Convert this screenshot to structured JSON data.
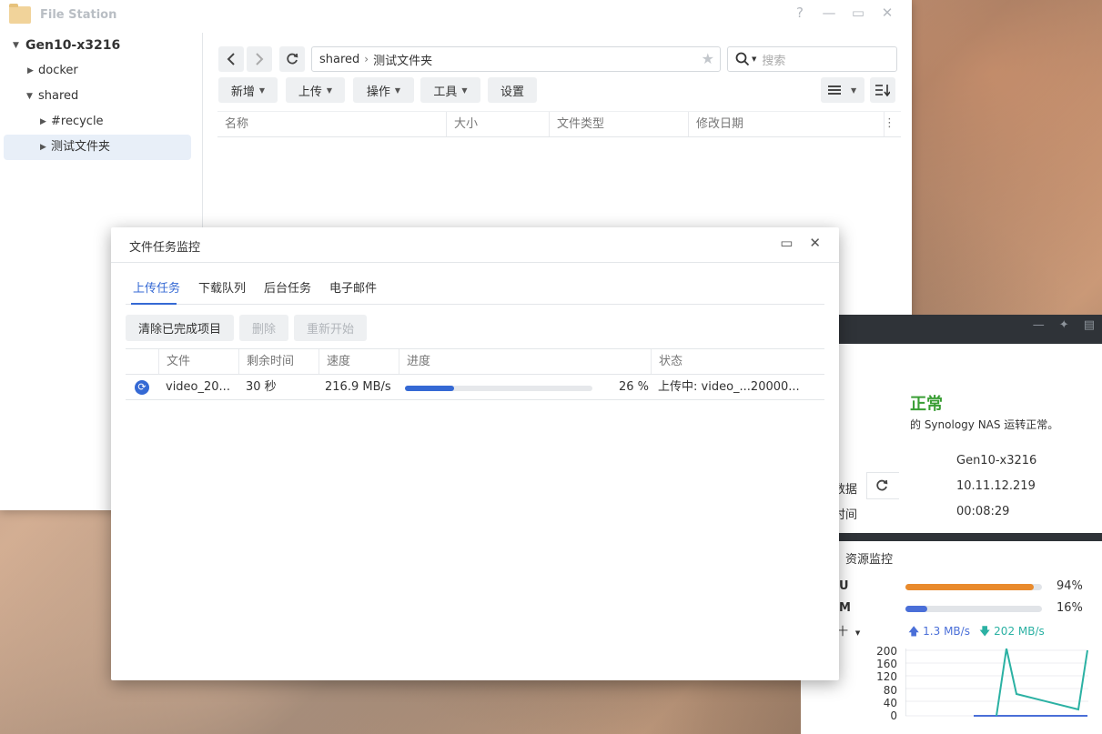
{
  "file_station": {
    "title": "File Station",
    "controls": [
      "?",
      "—",
      "▭",
      "✕"
    ],
    "tree": {
      "root": "Gen10-x3216",
      "items": [
        {
          "label": "docker"
        },
        {
          "label": "shared"
        },
        {
          "label": "#recycle"
        },
        {
          "label": "测试文件夹"
        }
      ]
    },
    "toolbar": {
      "path_root": "shared",
      "path_current": "测试文件夹",
      "search_placeholder": "搜索",
      "buttons": [
        "新增",
        "上传",
        "操作",
        "工具",
        "设置"
      ]
    },
    "columns": [
      "名称",
      "大小",
      "文件类型",
      "修改日期"
    ]
  },
  "task_monitor": {
    "title": "文件任务监控",
    "tabs": [
      "上传任务",
      "下载队列",
      "后台任务",
      "电子邮件"
    ],
    "buttons": {
      "clear": "清除已完成项目",
      "delete": "删除",
      "restart": "重新开始"
    },
    "columns": [
      "文件",
      "剩余时间",
      "速度",
      "进度",
      "状态"
    ],
    "rows": [
      {
        "file": "video_20...",
        "remaining": "30 秒",
        "speed": "216.9 MB/s",
        "progress": 26,
        "progress_label": "26 %",
        "status": "上传中: video_...20000..."
      }
    ]
  },
  "health_widget": {
    "status": "正常",
    "message": "的 Synology NAS 运转正常。",
    "rows": [
      {
        "label": "",
        "value": "Gen10-x3216"
      },
      {
        "label": "数据",
        "value": "10.11.12.219"
      },
      {
        "label": "时间",
        "value": "00:08:29"
      }
    ]
  },
  "resource_monitor": {
    "title": "资源监控",
    "cpu": {
      "label": "U",
      "value": 94,
      "text": "94%"
    },
    "ram": {
      "label": "M",
      "value": 16,
      "text": "16%"
    },
    "net_label": "十",
    "upload": "1.3 MB/s",
    "download": "202 MB/s",
    "chart_yticks": [
      "200",
      "160",
      "120",
      "80",
      "40",
      "0"
    ]
  },
  "colors": {
    "accent": "#3569d4",
    "cpu": "#e98a2c",
    "ram": "#4a6fd8",
    "ok": "#3a9e35",
    "download": "#2bb1a3"
  }
}
